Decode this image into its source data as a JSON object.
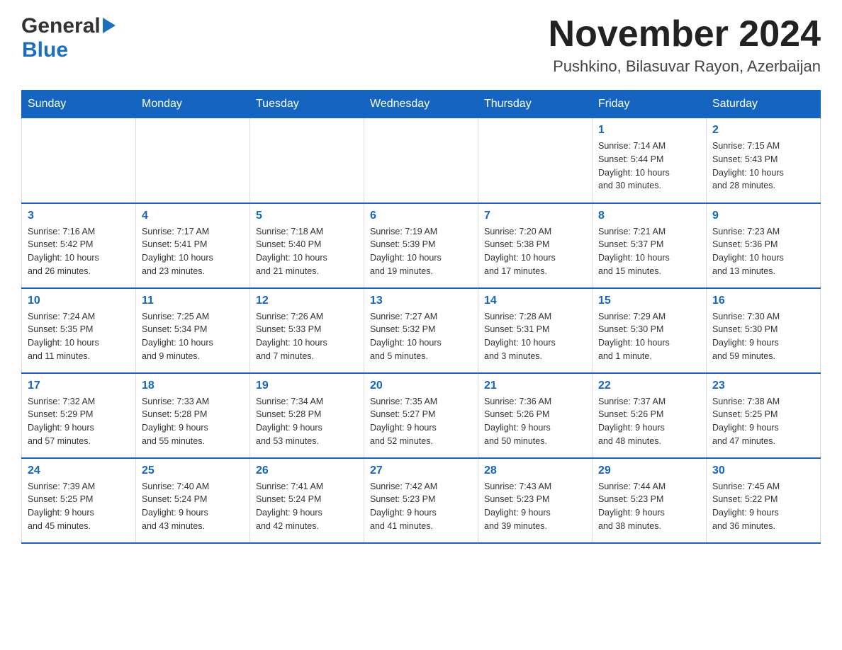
{
  "header": {
    "logo_general": "General",
    "logo_blue": "Blue",
    "month_title": "November 2024",
    "location": "Pushkino, Bilasuvar Rayon, Azerbaijan"
  },
  "days_of_week": [
    "Sunday",
    "Monday",
    "Tuesday",
    "Wednesday",
    "Thursday",
    "Friday",
    "Saturday"
  ],
  "weeks": [
    {
      "days": [
        {
          "number": "",
          "info": ""
        },
        {
          "number": "",
          "info": ""
        },
        {
          "number": "",
          "info": ""
        },
        {
          "number": "",
          "info": ""
        },
        {
          "number": "",
          "info": ""
        },
        {
          "number": "1",
          "info": "Sunrise: 7:14 AM\nSunset: 5:44 PM\nDaylight: 10 hours\nand 30 minutes."
        },
        {
          "number": "2",
          "info": "Sunrise: 7:15 AM\nSunset: 5:43 PM\nDaylight: 10 hours\nand 28 minutes."
        }
      ]
    },
    {
      "days": [
        {
          "number": "3",
          "info": "Sunrise: 7:16 AM\nSunset: 5:42 PM\nDaylight: 10 hours\nand 26 minutes."
        },
        {
          "number": "4",
          "info": "Sunrise: 7:17 AM\nSunset: 5:41 PM\nDaylight: 10 hours\nand 23 minutes."
        },
        {
          "number": "5",
          "info": "Sunrise: 7:18 AM\nSunset: 5:40 PM\nDaylight: 10 hours\nand 21 minutes."
        },
        {
          "number": "6",
          "info": "Sunrise: 7:19 AM\nSunset: 5:39 PM\nDaylight: 10 hours\nand 19 minutes."
        },
        {
          "number": "7",
          "info": "Sunrise: 7:20 AM\nSunset: 5:38 PM\nDaylight: 10 hours\nand 17 minutes."
        },
        {
          "number": "8",
          "info": "Sunrise: 7:21 AM\nSunset: 5:37 PM\nDaylight: 10 hours\nand 15 minutes."
        },
        {
          "number": "9",
          "info": "Sunrise: 7:23 AM\nSunset: 5:36 PM\nDaylight: 10 hours\nand 13 minutes."
        }
      ]
    },
    {
      "days": [
        {
          "number": "10",
          "info": "Sunrise: 7:24 AM\nSunset: 5:35 PM\nDaylight: 10 hours\nand 11 minutes."
        },
        {
          "number": "11",
          "info": "Sunrise: 7:25 AM\nSunset: 5:34 PM\nDaylight: 10 hours\nand 9 minutes."
        },
        {
          "number": "12",
          "info": "Sunrise: 7:26 AM\nSunset: 5:33 PM\nDaylight: 10 hours\nand 7 minutes."
        },
        {
          "number": "13",
          "info": "Sunrise: 7:27 AM\nSunset: 5:32 PM\nDaylight: 10 hours\nand 5 minutes."
        },
        {
          "number": "14",
          "info": "Sunrise: 7:28 AM\nSunset: 5:31 PM\nDaylight: 10 hours\nand 3 minutes."
        },
        {
          "number": "15",
          "info": "Sunrise: 7:29 AM\nSunset: 5:30 PM\nDaylight: 10 hours\nand 1 minute."
        },
        {
          "number": "16",
          "info": "Sunrise: 7:30 AM\nSunset: 5:30 PM\nDaylight: 9 hours\nand 59 minutes."
        }
      ]
    },
    {
      "days": [
        {
          "number": "17",
          "info": "Sunrise: 7:32 AM\nSunset: 5:29 PM\nDaylight: 9 hours\nand 57 minutes."
        },
        {
          "number": "18",
          "info": "Sunrise: 7:33 AM\nSunset: 5:28 PM\nDaylight: 9 hours\nand 55 minutes."
        },
        {
          "number": "19",
          "info": "Sunrise: 7:34 AM\nSunset: 5:28 PM\nDaylight: 9 hours\nand 53 minutes."
        },
        {
          "number": "20",
          "info": "Sunrise: 7:35 AM\nSunset: 5:27 PM\nDaylight: 9 hours\nand 52 minutes."
        },
        {
          "number": "21",
          "info": "Sunrise: 7:36 AM\nSunset: 5:26 PM\nDaylight: 9 hours\nand 50 minutes."
        },
        {
          "number": "22",
          "info": "Sunrise: 7:37 AM\nSunset: 5:26 PM\nDaylight: 9 hours\nand 48 minutes."
        },
        {
          "number": "23",
          "info": "Sunrise: 7:38 AM\nSunset: 5:25 PM\nDaylight: 9 hours\nand 47 minutes."
        }
      ]
    },
    {
      "days": [
        {
          "number": "24",
          "info": "Sunrise: 7:39 AM\nSunset: 5:25 PM\nDaylight: 9 hours\nand 45 minutes."
        },
        {
          "number": "25",
          "info": "Sunrise: 7:40 AM\nSunset: 5:24 PM\nDaylight: 9 hours\nand 43 minutes."
        },
        {
          "number": "26",
          "info": "Sunrise: 7:41 AM\nSunset: 5:24 PM\nDaylight: 9 hours\nand 42 minutes."
        },
        {
          "number": "27",
          "info": "Sunrise: 7:42 AM\nSunset: 5:23 PM\nDaylight: 9 hours\nand 41 minutes."
        },
        {
          "number": "28",
          "info": "Sunrise: 7:43 AM\nSunset: 5:23 PM\nDaylight: 9 hours\nand 39 minutes."
        },
        {
          "number": "29",
          "info": "Sunrise: 7:44 AM\nSunset: 5:23 PM\nDaylight: 9 hours\nand 38 minutes."
        },
        {
          "number": "30",
          "info": "Sunrise: 7:45 AM\nSunset: 5:22 PM\nDaylight: 9 hours\nand 36 minutes."
        }
      ]
    }
  ]
}
